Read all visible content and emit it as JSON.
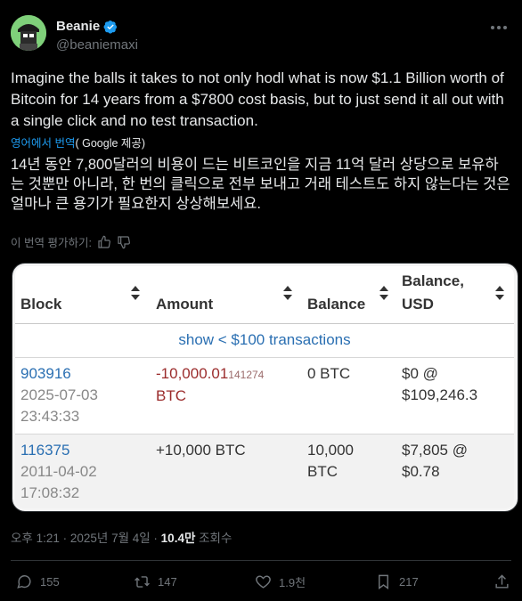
{
  "author": {
    "name": "Beanie",
    "handle": "@beaniemaxi"
  },
  "tweet": {
    "text": "Imagine the balls it takes to not only hodl what is now $1.1 Billion worth of Bitcoin for 14 years from a $7800 cost basis, but to just send it all out with a single click and no test transaction.",
    "translate_prefix": "영어에서 번역",
    "translate_by": "( Google 제공)",
    "translation": "14년 동안 7,800달러의 비용이 드는 비트코인을 지금 11억 달러 상당으로 보유하는 것뿐만 아니라, 한 번의 클릭으로 전부 보내고 거래 테스트도 하지 않는다는 것은 얼마나 큰 용기가 필요한지 상상해보세요.",
    "rate_label": "이 번역 평가하기:"
  },
  "table": {
    "headers": {
      "block": "Block",
      "amount": "Amount",
      "balance": "Balance",
      "balance_usd_1": "Balance,",
      "balance_usd_2": "USD"
    },
    "show_link": "show < $100 transactions",
    "rows": [
      {
        "block": "903916",
        "date": "2025-07-03",
        "time": "23:43:33",
        "amount_main": "-10,000.01",
        "amount_small": "141274",
        "amount_unit": "BTC",
        "balance": "0 BTC",
        "usd_1": "$0 @",
        "usd_2": "$109,246.3"
      },
      {
        "block": "116375",
        "date": "2011-04-02",
        "time": "17:08:32",
        "amount_main": "+10,000 BTC",
        "balance_1": "10,000",
        "balance_2": "BTC",
        "usd_1": "$7,805 @",
        "usd_2": "$0.78"
      }
    ]
  },
  "meta": {
    "time": "오후 1:21 · 2025년 7월 4일 · ",
    "views": "10.4만",
    "views_label": " 조회수"
  },
  "actions": {
    "replies": "155",
    "reposts": "147",
    "likes": "1.9천",
    "bookmarks": "217"
  },
  "colors": {
    "link_blue": "#1d9bf0",
    "avatar_green": "#7fd07a"
  }
}
